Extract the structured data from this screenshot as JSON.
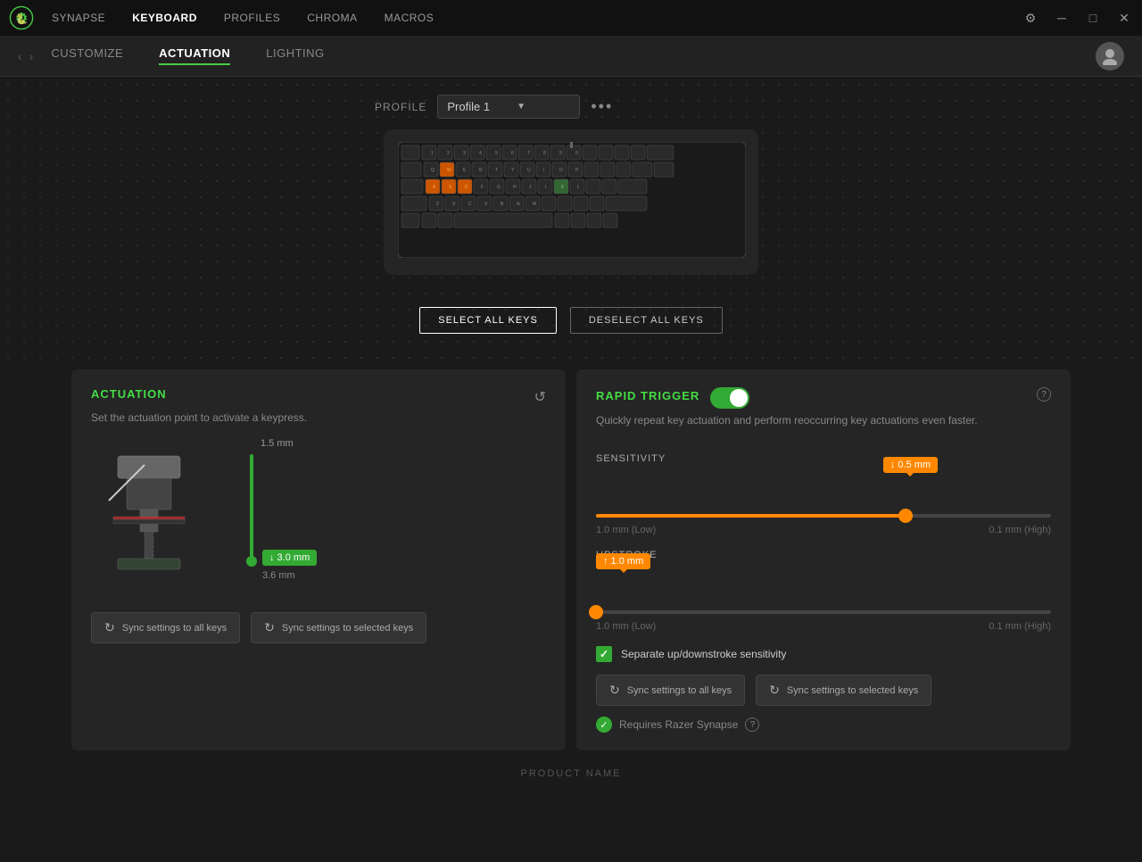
{
  "titlebar": {
    "nav_items": [
      "SYNAPSE",
      "KEYBOARD",
      "PROFILES",
      "CHROMA",
      "MACROS"
    ],
    "active_nav": "KEYBOARD"
  },
  "subnav": {
    "items": [
      "CUSTOMIZE",
      "ACTUATION",
      "LIGHTING"
    ],
    "active": "ACTUATION"
  },
  "profile": {
    "label": "PROFILE",
    "value": "Profile 1"
  },
  "keyboard": {
    "alt_text": "Keyboard Layout"
  },
  "buttons": {
    "select_all": "SELECT ALL KEYS",
    "deselect_all": "DESELECT ALL KEYS"
  },
  "actuation_panel": {
    "title": "ACTUATION",
    "description": "Set the actuation point to activate a keypress.",
    "depth_top_label": "1.5 mm",
    "depth_bottom_label": "3.6 mm",
    "depth_badge_value": "↓ 3.0 mm",
    "reset_icon": "↺",
    "sync_all_label": "Sync settings to all keys",
    "sync_selected_label": "Sync settings to selected keys"
  },
  "rapid_trigger_panel": {
    "title": "RAPID TRIGGER",
    "toggle_on": true,
    "description": "Quickly repeat key actuation and perform reoccurring key actuations even faster.",
    "sensitivity": {
      "label": "SENSITIVITY",
      "tooltip_value": "↓ 0.5 mm",
      "fill_percent": 68,
      "thumb_percent": 68,
      "low_label": "1.0 mm (Low)",
      "high_label": "0.1 mm (High)"
    },
    "upstroke": {
      "label": "UPSTROKE",
      "tooltip_value": "↑ 1.0 mm",
      "fill_percent": 0,
      "thumb_percent": 0,
      "low_label": "1.0 mm (Low)",
      "high_label": "0.1 mm (High)"
    },
    "checkbox": {
      "label": "Separate up/downstroke sensitivity",
      "checked": true
    },
    "sync_all_label": "Sync settings to all keys",
    "sync_selected_label": "Sync settings to selected keys",
    "requires_label": "Requires Razer Synapse"
  },
  "footer": {
    "product_name": "PRODUCT NAME"
  }
}
